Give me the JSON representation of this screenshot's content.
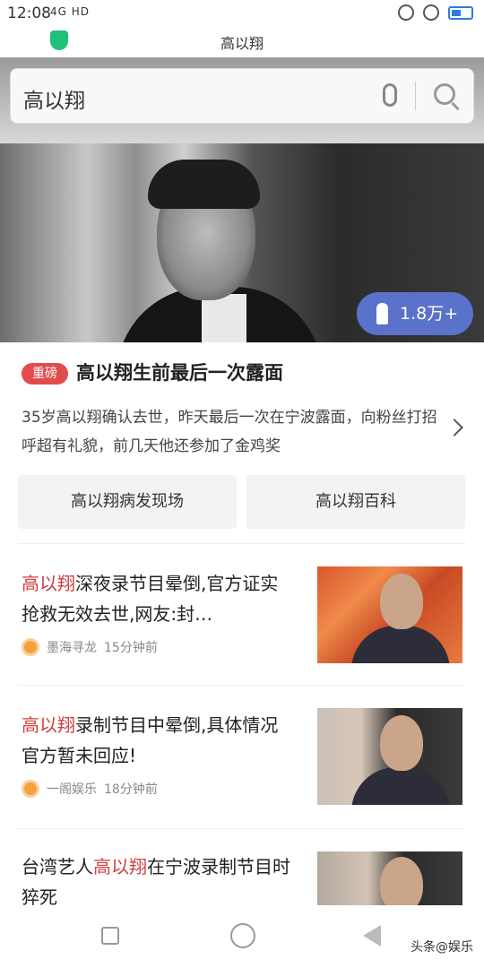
{
  "status_bar": {
    "time": "12:08",
    "signal": "4G HD"
  },
  "titlebar": {
    "title": "高以翔"
  },
  "search": {
    "query": "高以翔"
  },
  "hero": {
    "likes": "1.8万+"
  },
  "headline": {
    "badge": "重磅",
    "title": "高以翔生前最后一次露面",
    "summary": "35岁高以翔确认去世，昨天最后一次在宁波露面，向粉丝打招呼超有礼貌，前几天他还参加了金鸡奖"
  },
  "tags": [
    "高以翔病发现场",
    "高以翔百科"
  ],
  "news": [
    {
      "hl": "高以翔",
      "rest": "深夜录节目晕倒,官方证实抢救无效去世,网友:封…",
      "pre": "",
      "source": "墨海寻龙",
      "time": "15分钟前"
    },
    {
      "hl": "高以翔",
      "rest": "录制节目中晕倒,具体情况官方暂未回应!",
      "pre": "",
      "source": "一阁娱乐",
      "time": "18分钟前"
    },
    {
      "hl": "高以翔",
      "rest": "在宁波录制节目时猝死",
      "pre": "台湾艺人",
      "source": "",
      "time": ""
    }
  ],
  "watermark": "头条@娱乐"
}
